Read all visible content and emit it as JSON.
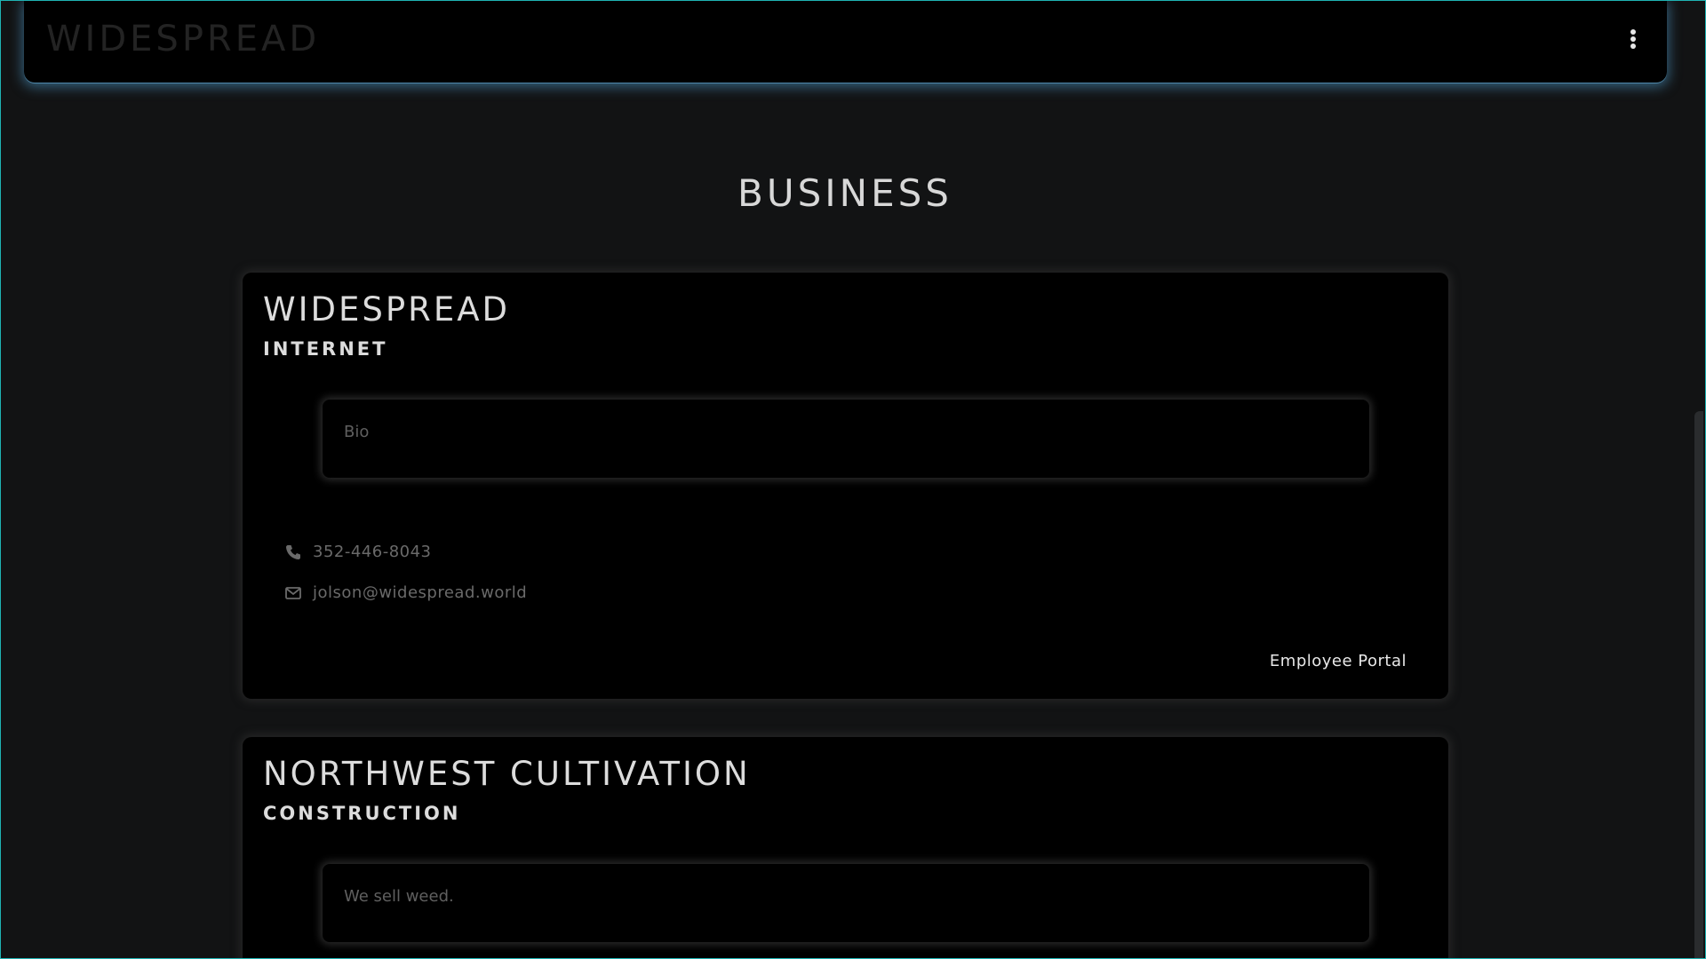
{
  "navbar": {
    "brand": "WIDESPREAD",
    "menu_icon": "kebab-menu-icon"
  },
  "page": {
    "title": "BUSINESS"
  },
  "businesses": [
    {
      "name": "WIDESPREAD",
      "category": "INTERNET",
      "bio": "Bio",
      "phone": "352-446-8043",
      "email": "jolson@widespread.world",
      "portal_label": "Employee Portal"
    },
    {
      "name": "NORTHWEST CULTIVATION",
      "category": "CONSTRUCTION",
      "bio": "We sell weed."
    }
  ],
  "colors": {
    "background": "#121314",
    "card": "#000000",
    "navbar_glow": "#50a0d2",
    "frame_border": "#1fb3b3"
  }
}
